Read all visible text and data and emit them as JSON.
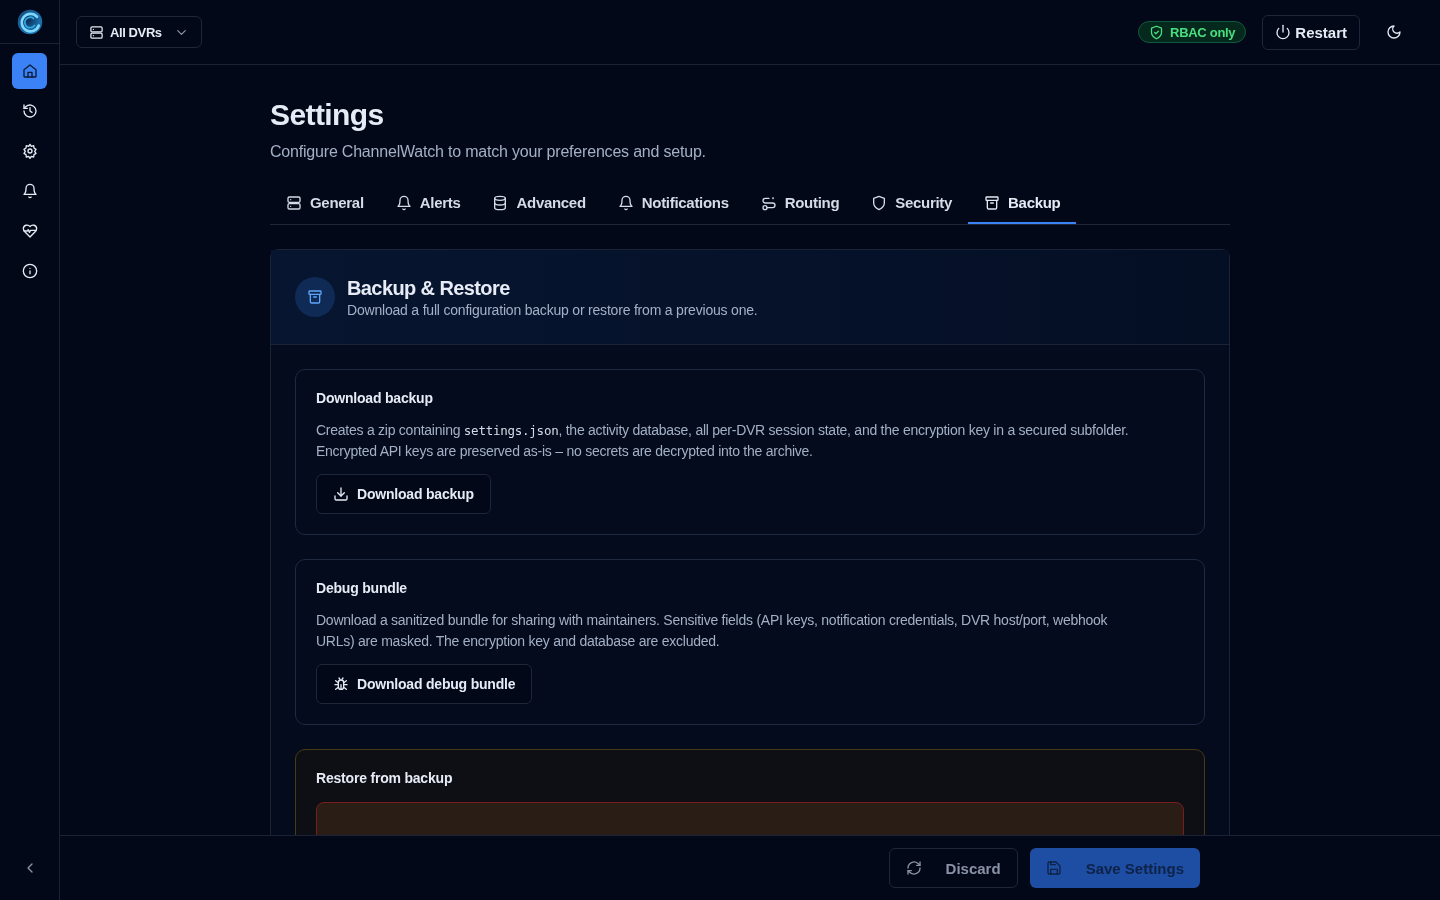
{
  "sidebar": {
    "items": [
      {
        "selected": true
      },
      {
        "selected": false
      },
      {
        "selected": false
      },
      {
        "selected": false
      },
      {
        "selected": false
      },
      {
        "selected": false
      }
    ]
  },
  "topbar": {
    "dvr_selector": "All DVRs",
    "badge": "RBAC only",
    "restart": "Restart"
  },
  "page": {
    "title": "Settings",
    "subtitle": "Configure ChannelWatch to match your preferences and setup."
  },
  "tabs": [
    {
      "label": "General",
      "selected": false
    },
    {
      "label": "Alerts",
      "selected": false
    },
    {
      "label": "Advanced",
      "selected": false
    },
    {
      "label": "Notifications",
      "selected": false
    },
    {
      "label": "Routing",
      "selected": false
    },
    {
      "label": "Security",
      "selected": false
    },
    {
      "label": "Backup",
      "selected": true
    }
  ],
  "panel": {
    "title": "Backup & Restore",
    "subtitle": "Download a full configuration backup or restore from a previous one."
  },
  "sections": [
    {
      "kind": "normal",
      "title": "Download backup",
      "description": [
        {
          "kind": "text",
          "text": "Creates a zip containing "
        },
        {
          "kind": "code",
          "text": "settings.json"
        },
        {
          "kind": "text",
          "text": ", the activity database, all per-DVR session state, and the encryption key in a secured subfolder. Encrypted API keys are preserved as-is – no secrets are decrypted into the archive."
        }
      ],
      "button": "Download backup"
    },
    {
      "kind": "normal",
      "title": "Debug bundle",
      "description": [
        {
          "kind": "text",
          "text": "Download a sanitized bundle for sharing with maintainers. Sensitive fields (API keys, notification credentials, DVR host/port, webhook URLs) are masked. The encryption key and database are excluded."
        }
      ],
      "button": "Download debug bundle"
    },
    {
      "kind": "warning",
      "title": "Restore from backup"
    }
  ],
  "footer": {
    "discard": {
      "label": "Discard",
      "disabled": true
    },
    "save": {
      "label": "Save Settings",
      "disabled": true
    }
  }
}
